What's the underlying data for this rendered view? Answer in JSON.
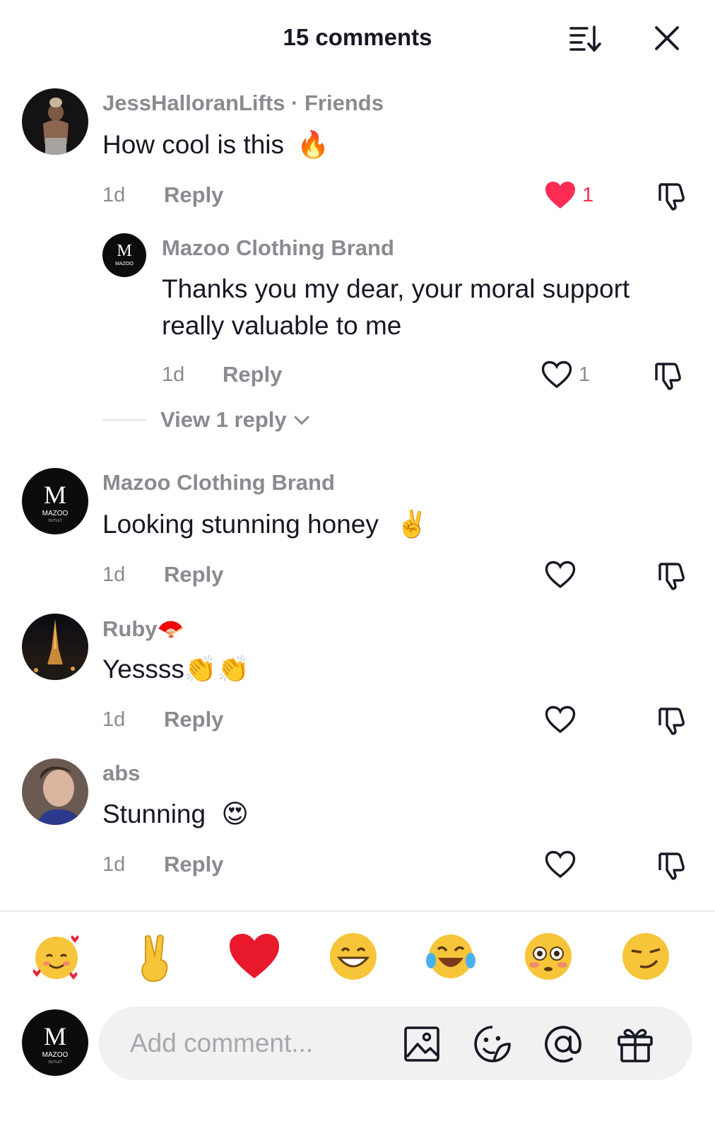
{
  "header": {
    "title": "15 comments"
  },
  "comments": [
    {
      "username": "JessHalloranLifts · Friends",
      "text": "How cool is this",
      "emoji": "🔥",
      "time": "1d",
      "reply_label": "Reply",
      "likes": "1",
      "liked": true
    },
    {
      "username": "Mazoo Clothing Brand",
      "text_line1": "Thanks you my dear, your moral support",
      "text_line2": "really valuable to me",
      "time": "1d",
      "reply_label": "Reply",
      "likes": "1",
      "liked": false
    },
    {
      "username": "Mazoo Clothing Brand",
      "text": "Looking stunning honey",
      "emoji": "✌️",
      "time": "1d",
      "reply_label": "Reply"
    },
    {
      "username": "Ruby",
      "username_emoji": "🪭",
      "text": "Yessss",
      "emoji": "👏👏",
      "time": "1d",
      "reply_label": "Reply"
    },
    {
      "username": "abs",
      "text": "Stunning",
      "emoji": "😍",
      "time": "1d",
      "reply_label": "Reply"
    }
  ],
  "view_replies": {
    "label": "View 1 reply"
  },
  "avatar_logo": {
    "letter": "M",
    "brand": "MAZOO",
    "sub": "OUTLET"
  },
  "emoji_bar": [
    "🥰",
    "✌️",
    "❤️",
    "😁",
    "😂",
    "😳",
    "😏"
  ],
  "input": {
    "placeholder": "Add comment..."
  },
  "colors": {
    "like_red": "#fe2c55",
    "muted": "#8a8b91",
    "input_bg": "#f1f1f2"
  },
  "icons": [
    "sort-icon",
    "close-icon",
    "heart-filled-icon",
    "heart-outline-icon",
    "dislike-icon",
    "chevron-down-icon",
    "image-icon",
    "sticker-icon",
    "mention-icon",
    "gift-icon"
  ]
}
